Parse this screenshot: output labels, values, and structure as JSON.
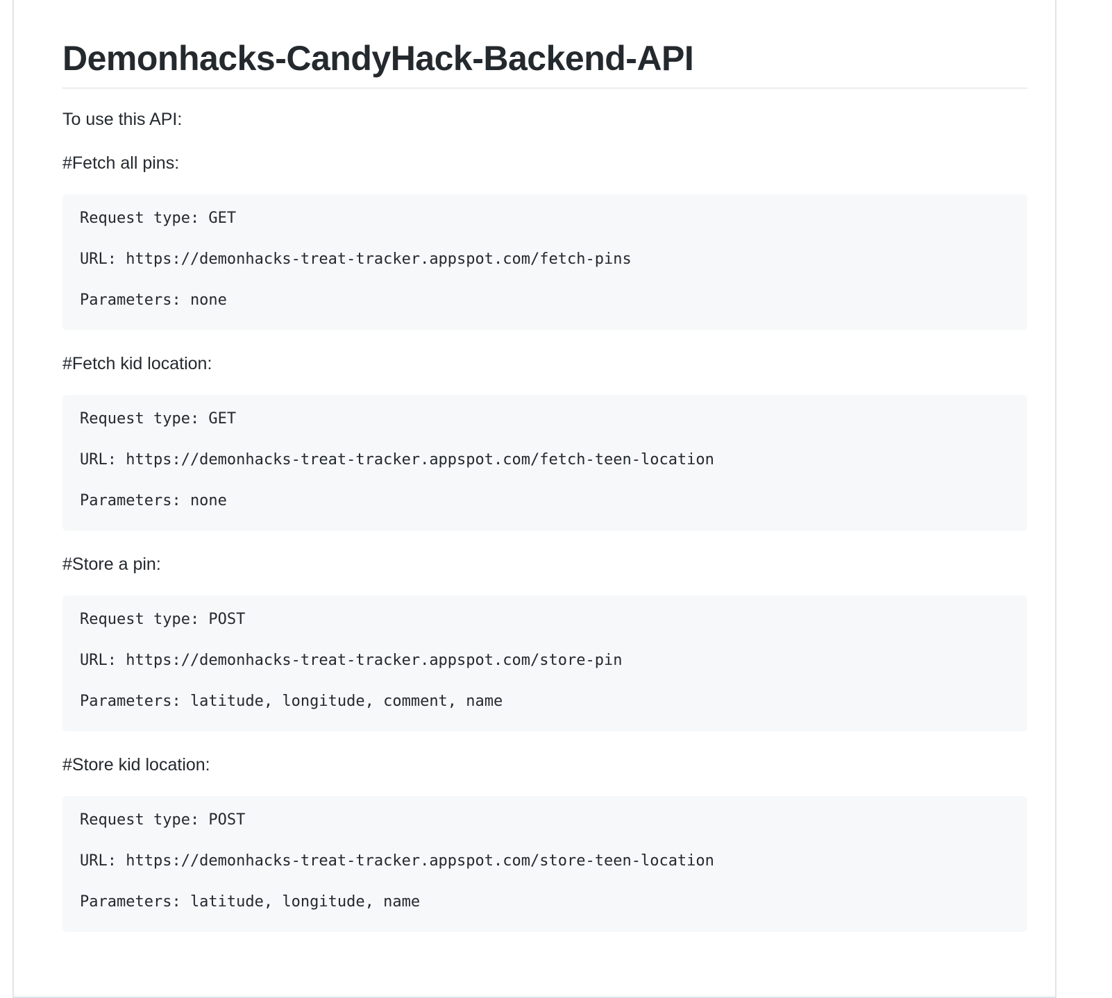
{
  "readme": {
    "title": "Demonhacks-CandyHack-Backend-API",
    "intro": "To use this API:",
    "sections": [
      {
        "heading": "#Fetch all pins:",
        "request_type": "Request type: GET",
        "url": "URL: https://demonhacks-treat-tracker.appspot.com/fetch-pins",
        "parameters": "Parameters: none"
      },
      {
        "heading": "#Fetch kid location:",
        "request_type": "Request type: GET",
        "url": "URL: https://demonhacks-treat-tracker.appspot.com/fetch-teen-location",
        "parameters": "Parameters: none"
      },
      {
        "heading": "#Store a pin:",
        "request_type": "Request type: POST",
        "url": "URL: https://demonhacks-treat-tracker.appspot.com/store-pin",
        "parameters": "Parameters: latitude, longitude, comment, name"
      },
      {
        "heading": "#Store kid location:",
        "request_type": "Request type: POST",
        "url": "URL: https://demonhacks-treat-tracker.appspot.com/store-teen-location",
        "parameters": "Parameters: latitude, longitude, name"
      }
    ]
  },
  "colors": {
    "text": "#24292e",
    "code_background": "#f6f8fa",
    "border": "#e1e4e8",
    "heading_rule": "#eaecef"
  }
}
